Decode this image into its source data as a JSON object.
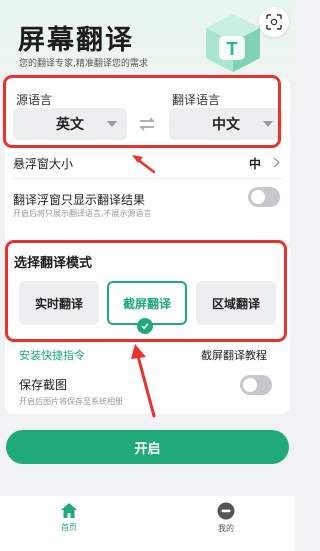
{
  "header": {
    "title": "屏幕翻译",
    "subtitle": "您的翻译专家,精准翻译您的需求",
    "logo_letter": "T"
  },
  "languages": {
    "source_label": "源语言",
    "target_label": "翻译语言",
    "source_value": "英文",
    "target_value": "中文"
  },
  "settings": {
    "float_size_label": "悬浮窗大小",
    "float_size_value": "中",
    "only_result_label": "翻译浮窗只显示翻译结果",
    "only_result_sub": "开启后将只展示翻译语言,不展示源语言",
    "only_result_on": false
  },
  "mode": {
    "title": "选择翻译模式",
    "options": [
      "实时翻译",
      "截屏翻译",
      "区域翻译"
    ],
    "selected": "截屏翻译"
  },
  "links": {
    "install_shortcut": "安装快捷指令",
    "tutorial": "截屏翻译教程"
  },
  "save_screenshot": {
    "label": "保存截图",
    "sub": "开启后图片将保存至系统相册",
    "on": false
  },
  "start_button": "开启",
  "tabbar": {
    "home": "首页",
    "mine": "我的"
  },
  "colors": {
    "accent": "#1faa78",
    "annotation": "#e8322c"
  }
}
